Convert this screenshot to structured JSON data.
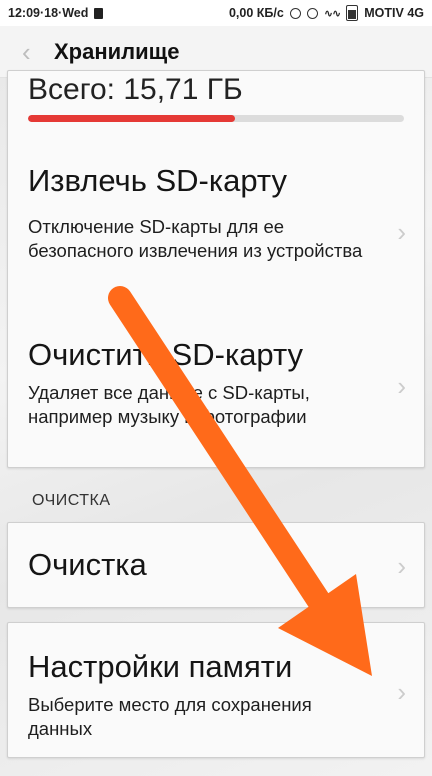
{
  "status_bar": {
    "time_day": "12:09·18·Wed",
    "speed": "0,00 КБ/с",
    "carrier": "MOTIV 4G"
  },
  "app_bar": {
    "title": "Хранилище",
    "back_icon": "chevron-left-icon"
  },
  "storage": {
    "total_label": "Всего: 15,71 ГБ",
    "used_fraction": 0.55,
    "bar_color": "#e53935"
  },
  "items": [
    {
      "title": "Извлечь SD-карту",
      "desc": "Отключение SD-карты для ее безопасного извлечения из устройства"
    },
    {
      "title": "Очистить SD-карту",
      "desc": "Удаляет все данные с SD-карты, например музыку и фотографии"
    },
    {
      "title": "Очистка",
      "desc": ""
    },
    {
      "title": "Настройки памяти",
      "desc": "Выберите место для сохранения данных"
    }
  ],
  "section": {
    "header": "ОЧИСТКА"
  },
  "chevron_glyph": "›",
  "annotation": {
    "arrow_color": "#ff6a1a"
  }
}
